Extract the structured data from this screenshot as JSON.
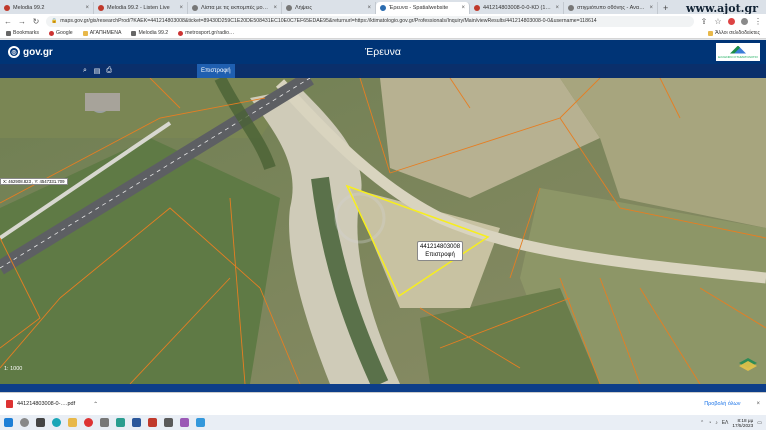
{
  "browser": {
    "tabs": [
      {
        "title": "Melodia 99.2",
        "active": false
      },
      {
        "title": "Melodia 99.2 - Listen Live",
        "active": false
      },
      {
        "title": "Λίστα με τις εκπομπές μου - Κλι…",
        "active": false
      },
      {
        "title": "Λήψεις",
        "active": false
      },
      {
        "title": "Έρευνα - Spatialwebsite",
        "active": true
      },
      {
        "title": "441214803008-0-0-KD (1).pdf",
        "active": false
      },
      {
        "title": "στιγμιότυπο οθόνης - Αναζήτ…",
        "active": false
      }
    ],
    "new_tab": "+",
    "url": "maps.gov.gr/gis/researchProd/?KAEK=441214803008&ticket=89430D259C1E20DE508431EC10E0C7EF65EDAE95&returnurl=https://ktimatologio.gov.gr/Professionals/Inquiry/Main/viewResults/441214803008-0-0&username=118614",
    "watermark": "www.ajot.gr"
  },
  "bookmarks": {
    "items": [
      {
        "label": "Bookmarks",
        "icon": "star-icon"
      },
      {
        "label": "Google",
        "icon": "google-icon"
      },
      {
        "label": "ΑΓΑΠΗΜΕΝΑ",
        "icon": "folder-icon"
      },
      {
        "label": "Melodia 99.2",
        "icon": "radio-icon"
      },
      {
        "label": "metrosport.gr/radio…",
        "icon": "metro-icon"
      }
    ],
    "other": "Άλλοι σελιδοδείκτες"
  },
  "header": {
    "logo_text": "gov.gr",
    "title": "Έρευνα",
    "org_logo_text": "ΕΛΛΗΝΙΚΟ ΚΤΗΜΑΤΟΛΟΓΙΟ"
  },
  "toolbar": {
    "buttons": [
      "search-icon",
      "document-icon",
      "print-icon"
    ],
    "back_label": "Επιστροφή"
  },
  "map": {
    "coords": "Χ: 462908.823 , Υ: 4547331.709",
    "scale": "1: 1000",
    "parcel_label": "441214803008",
    "parcel_action": "Επιστροφή",
    "colors": {
      "parcel_outline": "#f7ee1e",
      "cadastre_lines": "#e67e22"
    }
  },
  "downloads": {
    "file": "441214803008-0-….pdf",
    "show_all": "Προβολή όλων"
  },
  "taskbar": {
    "time": "8:18 μμ",
    "date": "17/5/2023",
    "lang": "ΕΛ"
  }
}
